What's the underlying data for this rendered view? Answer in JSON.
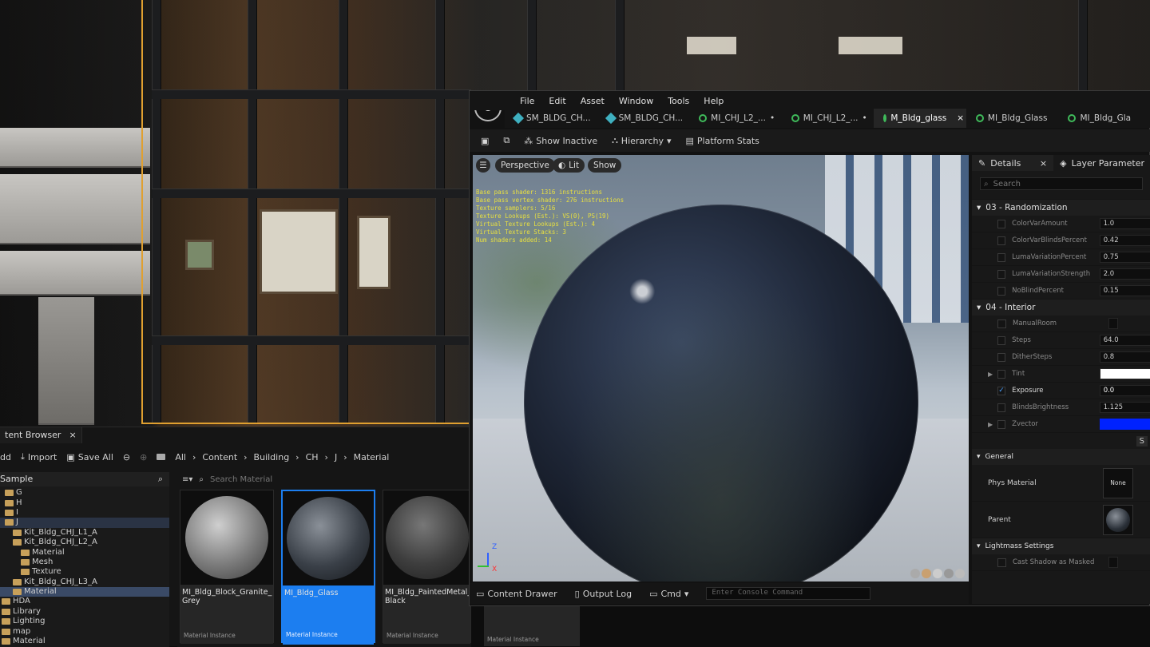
{
  "content_browser": {
    "tab_label": "tent Browser",
    "close": "×",
    "toolbar": {
      "add": "dd",
      "import": "Import",
      "save_all": "Save All"
    },
    "breadcrumb": [
      "All",
      "Content",
      "Building",
      "CH",
      "J",
      "Material"
    ],
    "sidebar_title": "Sample",
    "search_placeholder": "Search Material",
    "tree": [
      "G",
      "H",
      "I",
      "J",
      "Kit_Bldg_CHJ_L1_A",
      "Kit_Bldg_CHJ_L2_A",
      "Material",
      "Mesh",
      "Texture",
      "Kit_Bldg_CHJ_L3_A",
      "Material",
      "HDA",
      "Library",
      "Lighting",
      "map",
      "Material"
    ],
    "assets": [
      {
        "name": "MI_Bldg_Block_Granite_ Grey",
        "type": "Material Instance"
      },
      {
        "name": "MI_Bldg_Glass",
        "type": "Material Instance"
      },
      {
        "name": "MI_Bldg_PaintedMetal_ Black",
        "type": "Material Instance"
      },
      {
        "name": "",
        "type": "Material Instance"
      }
    ]
  },
  "editor": {
    "menu": [
      "File",
      "Edit",
      "Asset",
      "Window",
      "Tools",
      "Help"
    ],
    "tabs": [
      {
        "label": "SM_BLDG_CH...",
        "kind": "mesh"
      },
      {
        "label": "SM_BLDG_CH...",
        "kind": "mesh"
      },
      {
        "label": "MI_CHJ_L2_...",
        "kind": "material",
        "dirty": "•"
      },
      {
        "label": "MI_CHJ_L2_...",
        "kind": "material",
        "dirty": "•"
      },
      {
        "label": "M_Bldg_glass",
        "kind": "material",
        "active": true,
        "close": "×"
      },
      {
        "label": "MI_Bldg_Glass",
        "kind": "material"
      },
      {
        "label": "MI_Bldg_Gla",
        "kind": "material"
      }
    ],
    "toolbar": {
      "show_inactive": "Show Inactive",
      "hierarchy": "Hierarchy",
      "platform_stats": "Platform Stats"
    },
    "viewport": {
      "perspective": "Perspective",
      "lit": "Lit",
      "show": "Show",
      "stats": [
        "Base pass shader: 1316 instructions",
        "Base pass vertex shader: 276 instructions",
        "Texture samplers: 5/16",
        "Texture Lookups (Est.): VS(0), PS(19)",
        "Virtual Texture Lookups (Est.): 4",
        "Virtual Texture Stacks: 3",
        "Num shaders added: 14"
      ],
      "axis_x": "X",
      "axis_z": "Z"
    },
    "bottom": {
      "content_drawer": "Content Drawer",
      "output_log": "Output Log",
      "cmd": "Cmd",
      "console_placeholder": "Enter Console Command"
    }
  },
  "details": {
    "tab": "Details",
    "close": "×",
    "tab2": "Layer Parameter",
    "search_placeholder": "Search",
    "categories": [
      {
        "title": "03 - Randomization",
        "rows": [
          {
            "name": "ColorVarAmount",
            "value": "1.0"
          },
          {
            "name": "ColorVarBlindsPercent",
            "value": "0.42"
          },
          {
            "name": "LumaVariationPercent",
            "value": "0.75"
          },
          {
            "name": "LumaVariationStrength",
            "value": "2.0"
          },
          {
            "name": "NoBlindPercent",
            "value": "0.15"
          }
        ]
      },
      {
        "title": "04 - Interior",
        "rows": [
          {
            "name": "ManualRoom",
            "value": ""
          },
          {
            "name": "Steps",
            "value": "64.0"
          },
          {
            "name": "DitherSteps",
            "value": "0.8"
          },
          {
            "name": "Tint",
            "value": ""
          },
          {
            "name": "Exposure",
            "value": "0.0",
            "checked": "✓"
          },
          {
            "name": "BlindsBrightness",
            "value": "1.125"
          },
          {
            "name": "Zvector",
            "value": ""
          }
        ]
      }
    ],
    "general": {
      "title": "General",
      "phys_material": "Phys Material",
      "phys_value": "None",
      "parent": "Parent",
      "save": "S"
    },
    "lightmass": {
      "title": "Lightmass Settings",
      "cast_shadow": "Cast Shadow as Masked"
    },
    "colors": {
      "tint": "#ffffff",
      "zvector": "#0022ff",
      "accent": "#1c7ef0"
    }
  }
}
